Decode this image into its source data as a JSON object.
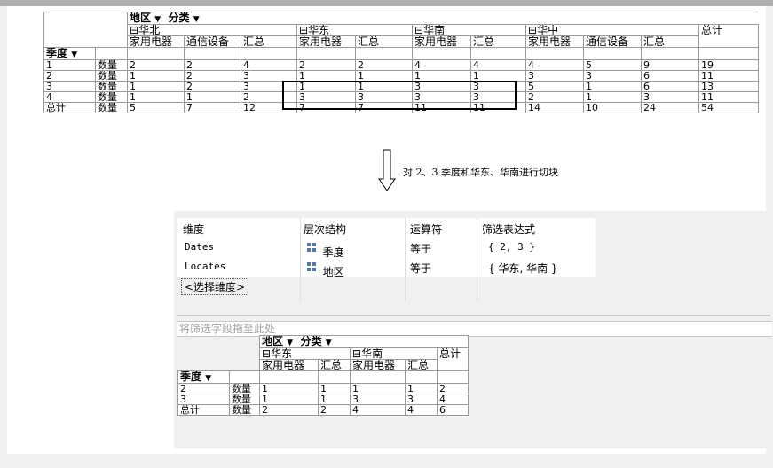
{
  "top_pivot": {
    "region_filter": "地区",
    "category_filter": "分类",
    "grand_total_label": "总计",
    "quarter_label": "季度",
    "regions": [
      {
        "name": "华北",
        "collapse": "⊟",
        "columns": [
          "家用电器",
          "通信设备",
          "汇总"
        ]
      },
      {
        "name": "华东",
        "collapse": "⊟",
        "columns": [
          "家用电器",
          "汇总"
        ]
      },
      {
        "name": "华南",
        "collapse": "⊟",
        "columns": [
          "家用电器",
          "汇总"
        ]
      },
      {
        "name": "华中",
        "collapse": "⊟",
        "columns": [
          "家用电器",
          "通信设备",
          "汇总"
        ]
      }
    ],
    "rows": [
      {
        "label": "1",
        "measure": "数量",
        "values": [
          "2",
          "2",
          "4",
          "2",
          "2",
          "4",
          "4",
          "4",
          "5",
          "9",
          "19"
        ]
      },
      {
        "label": "2",
        "measure": "数量",
        "values": [
          "1",
          "2",
          "3",
          "1",
          "1",
          "1",
          "1",
          "3",
          "3",
          "6",
          "11"
        ]
      },
      {
        "label": "3",
        "measure": "数量",
        "values": [
          "1",
          "2",
          "3",
          "1",
          "1",
          "3",
          "3",
          "5",
          "1",
          "6",
          "13"
        ]
      },
      {
        "label": "4",
        "measure": "数量",
        "values": [
          "1",
          "1",
          "2",
          "3",
          "3",
          "3",
          "3",
          "2",
          "1",
          "3",
          "11"
        ]
      },
      {
        "label": "总计",
        "measure": "数量",
        "values": [
          "5",
          "7",
          "12",
          "7",
          "7",
          "11",
          "11",
          "14",
          "10",
          "24",
          "54"
        ]
      }
    ]
  },
  "annotation": "对 2、3 季度和华东、华南进行切块",
  "filter_grid": {
    "headers": [
      "维度",
      "层次结构",
      "运算符",
      "筛选表达式"
    ],
    "rows": [
      {
        "dimension": "Dates",
        "hierarchy": "季度",
        "operator": "等于",
        "expression": "{ 2, 3 }"
      },
      {
        "dimension": "Locates",
        "hierarchy": "地区",
        "operator": "等于",
        "expression": "{ 华东, 华南 }"
      }
    ],
    "select_dimension": "<选择维度>"
  },
  "drop_zone": "将筛选字段拖至此处",
  "bottom_pivot": {
    "region_filter": "地区",
    "category_filter": "分类",
    "grand_total_label": "总计",
    "quarter_label": "季度",
    "regions": [
      {
        "name": "华东",
        "collapse": "⊟",
        "columns": [
          "家用电器",
          "汇总"
        ]
      },
      {
        "name": "华南",
        "collapse": "⊟",
        "columns": [
          "家用电器",
          "汇总"
        ]
      }
    ],
    "rows": [
      {
        "label": "2",
        "measure": "数量",
        "values": [
          "1",
          "1",
          "1",
          "1",
          "2"
        ]
      },
      {
        "label": "3",
        "measure": "数量",
        "values": [
          "1",
          "1",
          "3",
          "3",
          "4"
        ]
      },
      {
        "label": "总计",
        "measure": "数量",
        "values": [
          "2",
          "2",
          "4",
          "4",
          "6"
        ]
      }
    ]
  },
  "dropdown_glyph": "▼"
}
